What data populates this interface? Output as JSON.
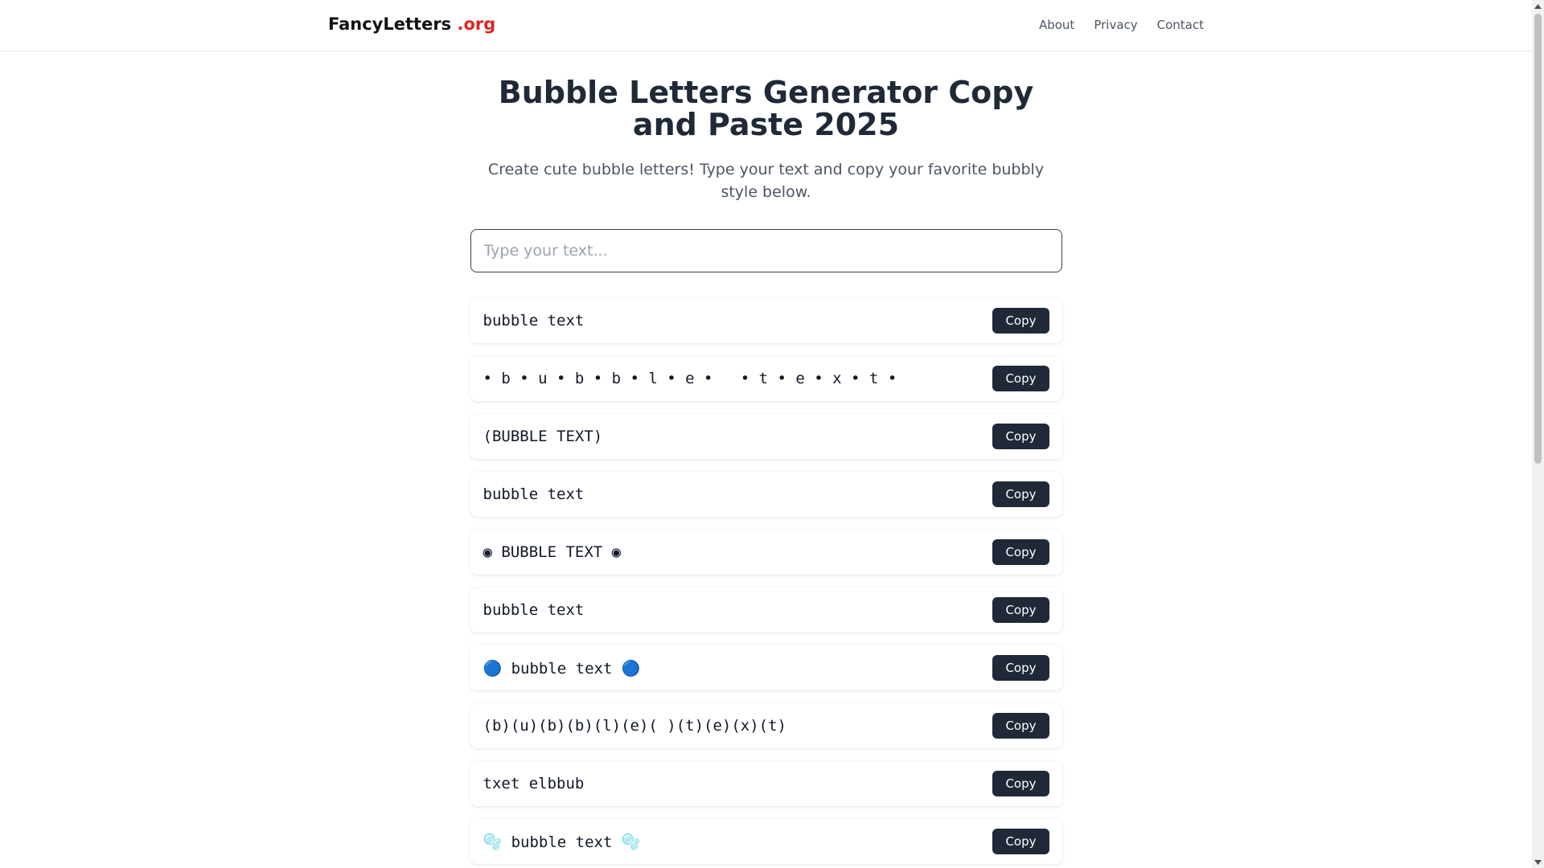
{
  "header": {
    "brand_name": "FancyLetters",
    "brand_tld": ".org",
    "nav": [
      "About",
      "Privacy",
      "Contact"
    ]
  },
  "main": {
    "title": "Bubble Letters Generator Copy and Paste 2025",
    "subtitle": "Create cute bubble letters! Type your text and copy your favorite bubbly style below.",
    "input": {
      "value": "",
      "placeholder": "Type your text..."
    },
    "copy_label": "Copy",
    "styles": [
      "bubble text",
      "• b • u • b • b • l • e •   • t • e • x • t •",
      "(BUBBLE TEXT)",
      "bubble text",
      "◉ BUBBLE TEXT ◉",
      "bubble text",
      "🔵 bubble text 🔵",
      "(b)(u)(b)(b)(l)(e)( )(t)(e)(x)(t)",
      "txet elbbub",
      "🫧 bubble text 🫧"
    ]
  },
  "colors": {
    "brand_accent": "#dc2626",
    "button_bg": "#1f2937",
    "heading": "#1f2937",
    "muted": "#4b5563"
  }
}
